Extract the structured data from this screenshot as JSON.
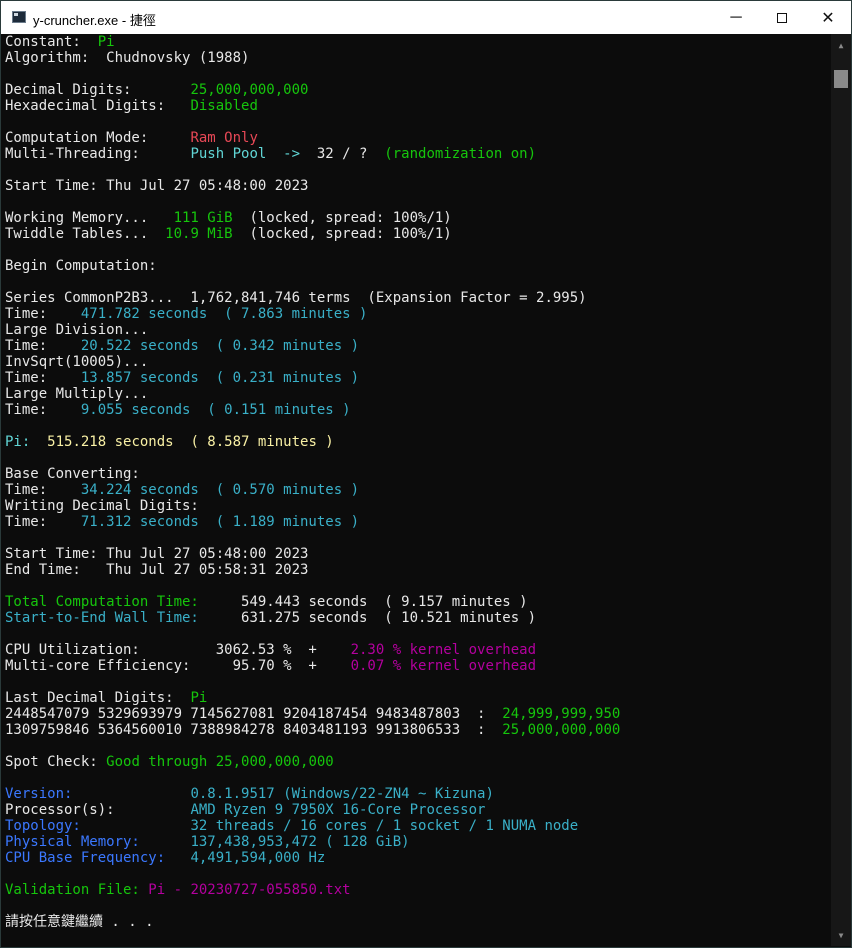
{
  "window": {
    "title": "y-cruncher.exe - 捷徑",
    "minimize": "─",
    "close": "✕"
  },
  "colors": {
    "white": "#e8e8e8",
    "gray": "#c0c0c0",
    "green": "#16c60c",
    "red": "#e74856",
    "cyan": "#61d6d6",
    "teal": "#3ab0c8",
    "yellow": "#f9f1a5",
    "magenta": "#b4009e",
    "blue": "#3b78ff"
  },
  "lines": [
    [
      [
        "Constant:  ",
        "white"
      ],
      [
        "Pi",
        "green"
      ]
    ],
    [
      [
        "Algorithm:  Chudnovsky (1988)",
        "white"
      ]
    ],
    [],
    [
      [
        "Decimal Digits:       ",
        "white"
      ],
      [
        "25,000,000,000",
        "green"
      ]
    ],
    [
      [
        "Hexadecimal Digits:   ",
        "white"
      ],
      [
        "Disabled",
        "green"
      ]
    ],
    [],
    [
      [
        "Computation Mode:     ",
        "white"
      ],
      [
        "Ram Only",
        "red"
      ]
    ],
    [
      [
        "Multi-Threading:      ",
        "white"
      ],
      [
        "Push Pool  ->  ",
        "cyan"
      ],
      [
        "32 / ?",
        "white"
      ],
      [
        "  (randomization on)",
        "green"
      ]
    ],
    [],
    [
      [
        "Start Time: Thu Jul 27 05:48:00 2023",
        "white"
      ]
    ],
    [],
    [
      [
        "Working Memory...   ",
        "white"
      ],
      [
        "111 GiB",
        "green"
      ],
      [
        "  (locked, spread: 100%/1)",
        "white"
      ]
    ],
    [
      [
        "Twiddle Tables...  ",
        "white"
      ],
      [
        "10.9 MiB",
        "green"
      ],
      [
        "  (locked, spread: 100%/1)",
        "white"
      ]
    ],
    [],
    [
      [
        "Begin Computation:",
        "white"
      ]
    ],
    [],
    [
      [
        "Series CommonP2B3...  1,762,841,746 terms  (Expansion Factor = 2.995)",
        "white"
      ]
    ],
    [
      [
        "Time:    ",
        "white"
      ],
      [
        "471.782 seconds  ( 7.863 minutes )",
        "teal"
      ]
    ],
    [
      [
        "Large Division...",
        "white"
      ]
    ],
    [
      [
        "Time:    ",
        "white"
      ],
      [
        "20.522 seconds  ( 0.342 minutes )",
        "teal"
      ]
    ],
    [
      [
        "InvSqrt(10005)...",
        "white"
      ]
    ],
    [
      [
        "Time:    ",
        "white"
      ],
      [
        "13.857 seconds  ( 0.231 minutes )",
        "teal"
      ]
    ],
    [
      [
        "Large Multiply...",
        "white"
      ]
    ],
    [
      [
        "Time:    ",
        "white"
      ],
      [
        "9.055 seconds  ( 0.151 minutes )",
        "teal"
      ]
    ],
    [],
    [
      [
        "Pi:",
        "cyan"
      ],
      [
        "  515.218 seconds  ( 8.587 minutes )",
        "yellow"
      ]
    ],
    [],
    [
      [
        "Base Converting:",
        "white"
      ]
    ],
    [
      [
        "Time:    ",
        "white"
      ],
      [
        "34.224 seconds  ( 0.570 minutes )",
        "teal"
      ]
    ],
    [
      [
        "Writing Decimal Digits:",
        "white"
      ]
    ],
    [
      [
        "Time:    ",
        "white"
      ],
      [
        "71.312 seconds  ( 1.189 minutes )",
        "teal"
      ]
    ],
    [],
    [
      [
        "Start Time: Thu Jul 27 05:48:00 2023",
        "white"
      ]
    ],
    [
      [
        "End Time:   Thu Jul 27 05:58:31 2023",
        "white"
      ]
    ],
    [],
    [
      [
        "Total Computation Time:     ",
        "green"
      ],
      [
        "549.443 seconds  ( 9.157 minutes )",
        "white"
      ]
    ],
    [
      [
        "Start-to-End Wall Time:     ",
        "teal"
      ],
      [
        "631.275 seconds  ( 10.521 minutes )",
        "white"
      ]
    ],
    [],
    [
      [
        "CPU Utilization:         3062.53 %  +    ",
        "white"
      ],
      [
        "2.30 % kernel overhead",
        "magenta"
      ]
    ],
    [
      [
        "Multi-core Efficiency:     95.70 %  +    ",
        "white"
      ],
      [
        "0.07 % kernel overhead",
        "magenta"
      ]
    ],
    [],
    [
      [
        "Last Decimal Digits:  ",
        "white"
      ],
      [
        "Pi",
        "green"
      ]
    ],
    [
      [
        "2448547079 5329693979 7145627081 9204187454 9483487803  :  ",
        "white"
      ],
      [
        "24,999,999,950",
        "green"
      ]
    ],
    [
      [
        "1309759846 5364560010 7388984278 8403481193 9913806533  :  ",
        "white"
      ],
      [
        "25,000,000,000",
        "green"
      ]
    ],
    [],
    [
      [
        "Spot Check: ",
        "white"
      ],
      [
        "Good through 25,000,000,000",
        "green"
      ]
    ],
    [],
    [
      [
        "Version:              ",
        "blue"
      ],
      [
        "0.8.1.9517 (Windows/22-ZN4 ~ Kizuna)",
        "teal"
      ]
    ],
    [
      [
        "Processor(s):         ",
        "white"
      ],
      [
        "AMD Ryzen 9 7950X 16-Core Processor",
        "teal"
      ]
    ],
    [
      [
        "Topology:             ",
        "blue"
      ],
      [
        "32 threads / 16 cores / 1 socket / 1 NUMA node",
        "teal"
      ]
    ],
    [
      [
        "Physical Memory:      ",
        "blue"
      ],
      [
        "137,438,953,472 ( 128 GiB)",
        "teal"
      ]
    ],
    [
      [
        "CPU Base Frequency:   ",
        "blue"
      ],
      [
        "4,491,594,000 Hz",
        "teal"
      ]
    ],
    [],
    [
      [
        "Validation File: ",
        "green"
      ],
      [
        "Pi - 20230727-055850.txt",
        "magenta"
      ]
    ],
    [],
    [
      [
        "請按任意鍵繼續 . . .",
        "white"
      ]
    ]
  ]
}
